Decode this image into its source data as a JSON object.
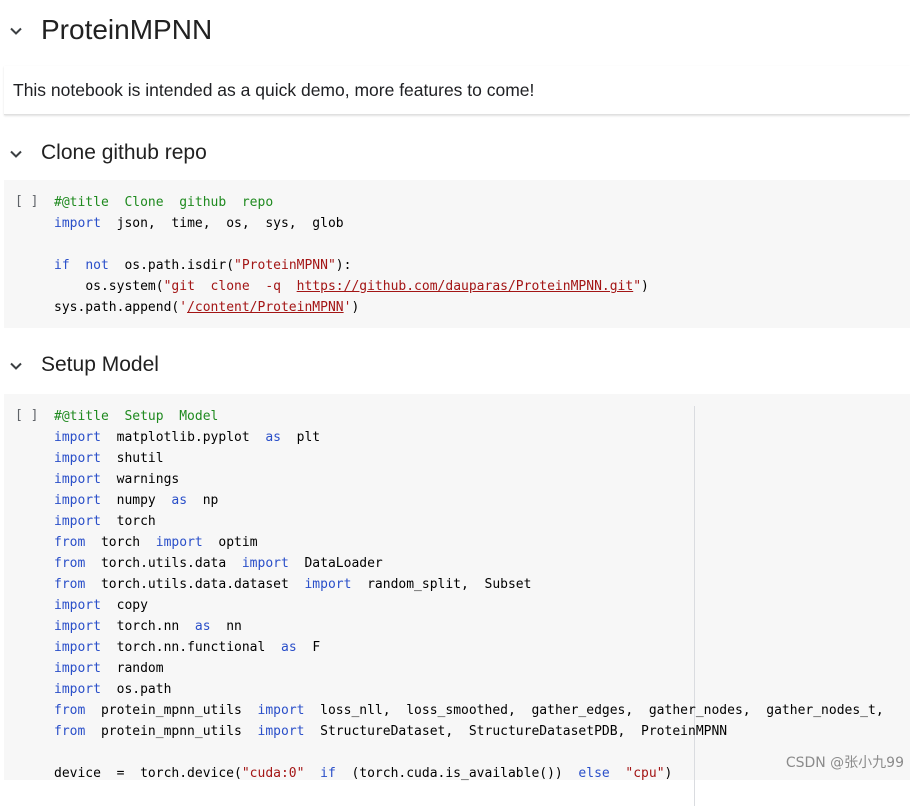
{
  "sections": {
    "intro": {
      "title": "ProteinMPNN",
      "text": "This notebook is intended as a quick demo, more features to come!"
    },
    "clone": {
      "title": "Clone github repo",
      "run_label": "[ ]",
      "code": {
        "title_comment": "#@title  Clone  github  repo",
        "import_kw": "import",
        "import_list": "json,  time,  os,  sys,  glob",
        "if_kw": "if",
        "not_kw": "not",
        "isdir_call": "os.path.isdir(",
        "isdir_arg": "\"ProteinMPNN\"",
        "isdir_close": "):",
        "system_call": "os.system(",
        "git_cmd": "\"git  clone  -q  ",
        "git_url": "https://github.com/dauparas/ProteinMPNN.git",
        "git_end": "\"",
        "system_close": ")",
        "append_call": "sys.path.append(",
        "append_q1": "'",
        "append_path": "/content/ProteinMPNN",
        "append_q2": "'",
        "append_close": ")"
      }
    },
    "setup": {
      "title": "Setup Model",
      "run_label": "[ ]",
      "code": {
        "title_comment": "#@title  Setup  Model",
        "kw_import": "import",
        "kw_from": "from",
        "kw_as": "as",
        "kw_if": "if",
        "kw_else": "else",
        "mod_matplotlib": "matplotlib.pyplot",
        "alias_plt": "plt",
        "mod_shutil": "shutil",
        "mod_warnings": "warnings",
        "mod_numpy": "numpy",
        "alias_np": "np",
        "mod_torch": "torch",
        "from_torch": "torch",
        "name_optim": "optim",
        "mod_utils_data": "torch.utils.data",
        "name_dataloader": "DataLoader",
        "mod_utils_dataset": "torch.utils.data.dataset",
        "name_random_split": "random_split,  Subset",
        "mod_copy": "copy",
        "mod_nn": "torch.nn",
        "alias_nn": "nn",
        "mod_functional": "torch.nn.functional",
        "alias_F": "F",
        "mod_random": "random",
        "mod_ospath": "os.path",
        "mod_pmu": "protein_mpnn_utils",
        "names_pmu_1": "loss_nll,  loss_smoothed,  gather_edges,  gather_nodes,  gather_nodes_t,",
        "names_pmu_2": "StructureDataset,  StructureDatasetPDB,  ProteinMPNN",
        "device_assign": "device  =  torch.device(",
        "device_cuda": "\"cuda:0\"",
        "device_cond": "(torch.cuda.is_available())",
        "device_cpu": "\"cpu\"",
        "device_close": ")"
      }
    }
  },
  "watermark": "CSDN @张小九99"
}
